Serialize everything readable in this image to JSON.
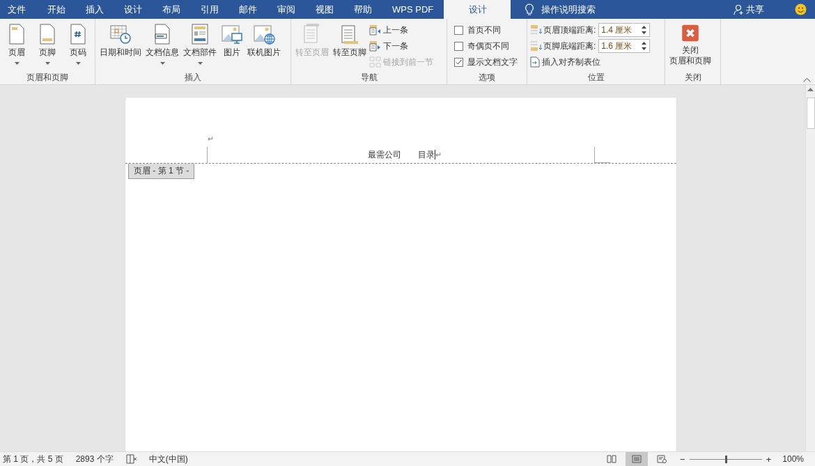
{
  "tabs": [
    {
      "label": "文件",
      "selected": false
    },
    {
      "label": "开始",
      "selected": false
    },
    {
      "label": "插入",
      "selected": false
    },
    {
      "label": "设计",
      "selected": false
    },
    {
      "label": "布局",
      "selected": false
    },
    {
      "label": "引用",
      "selected": false
    },
    {
      "label": "邮件",
      "selected": false
    },
    {
      "label": "审阅",
      "selected": false
    },
    {
      "label": "视图",
      "selected": false
    },
    {
      "label": "帮助",
      "selected": false
    },
    {
      "label": "WPS PDF",
      "selected": false
    },
    {
      "label": "设计",
      "selected": true
    }
  ],
  "tell_me": "操作说明搜索",
  "share": "共享",
  "groups": [
    {
      "label": "页眉和页脚",
      "buttons": [
        {
          "label": "页眉",
          "dropdown": true,
          "disabled": false
        },
        {
          "label": "页脚",
          "dropdown": true,
          "disabled": false
        },
        {
          "label": "页码",
          "dropdown": true,
          "disabled": false
        }
      ]
    },
    {
      "label": "插入",
      "buttons": [
        {
          "label": "日期和时间",
          "dropdown": false,
          "disabled": false
        },
        {
          "label": "文档信息",
          "dropdown": true,
          "disabled": false
        },
        {
          "label": "文档部件",
          "dropdown": true,
          "disabled": false
        },
        {
          "label": "图片",
          "dropdown": false,
          "disabled": false
        },
        {
          "label": "联机图片",
          "dropdown": false,
          "disabled": false
        }
      ]
    },
    {
      "label": "导航",
      "buttons": [
        {
          "label": "转至页眉",
          "dropdown": false,
          "disabled": true
        },
        {
          "label": "转至页脚",
          "dropdown": false,
          "disabled": false
        }
      ],
      "small_buttons": [
        {
          "label": "上一条",
          "disabled": false
        },
        {
          "label": "下一条",
          "disabled": false
        },
        {
          "label": "链接到前一节",
          "disabled": true
        }
      ]
    },
    {
      "label": "选项",
      "checkboxes": [
        {
          "label": "首页不同",
          "checked": false
        },
        {
          "label": "奇偶页不同",
          "checked": false
        },
        {
          "label": "显示文档文字",
          "checked": true
        }
      ]
    },
    {
      "label": "位置",
      "spinners": [
        {
          "label": "页眉顶端距离:",
          "value": "1.4 厘米"
        },
        {
          "label": "页脚底端距离:",
          "value": "1.6 厘米"
        }
      ],
      "small_buttons": [
        {
          "label": "插入对齐制表位",
          "disabled": false
        }
      ]
    },
    {
      "label": "关闭",
      "buttons": [
        {
          "label_lines": [
            "关闭",
            "页眉和页脚"
          ],
          "dropdown": false,
          "disabled": false
        }
      ]
    }
  ],
  "document": {
    "top_mark": "↵",
    "header_left": "最需公司",
    "header_right": "目录",
    "end_mark": "↵",
    "section_tag": "页眉 - 第 1 节 -"
  },
  "status_bar": {
    "page": "第 1 页，共 5 页",
    "words": "2893 个字",
    "language": "中文(中国)",
    "views": [
      {
        "selected": false
      },
      {
        "selected": true
      },
      {
        "selected": false
      }
    ],
    "minus": "−",
    "plus": "+",
    "zoom_slider": {
      "level": 0.5
    },
    "zoom": "100%"
  }
}
